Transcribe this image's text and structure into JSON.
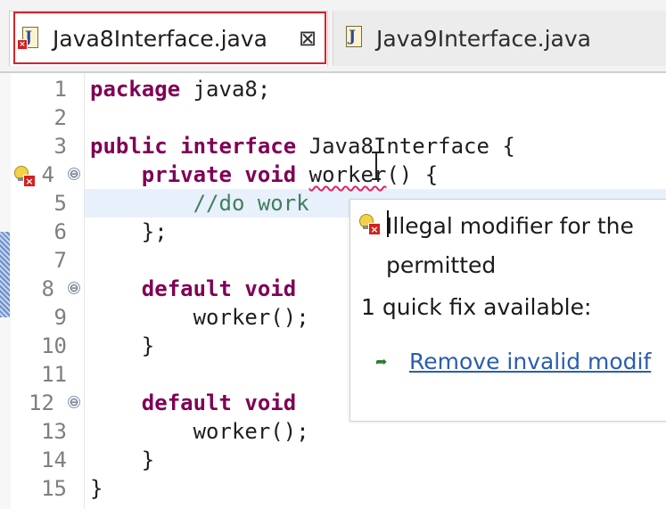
{
  "tabs": [
    {
      "label": "Java8Interface.java",
      "icon": "java-file-error-icon",
      "active": true,
      "close_glyph": "⊠"
    },
    {
      "label": "Java9Interface.java",
      "icon": "java-file-icon",
      "active": false
    }
  ],
  "editor": {
    "lines": [
      {
        "n": "1"
      },
      {
        "n": "2"
      },
      {
        "n": "3"
      },
      {
        "n": "4"
      },
      {
        "n": "5"
      },
      {
        "n": "6"
      },
      {
        "n": "7"
      },
      {
        "n": "8"
      },
      {
        "n": "9"
      },
      {
        "n": "10"
      },
      {
        "n": "11"
      },
      {
        "n": "12"
      },
      {
        "n": "13"
      },
      {
        "n": "14"
      },
      {
        "n": "15"
      }
    ],
    "code": {
      "l1_kw": "package",
      "l1_rest": " java8;",
      "l3_kw1": "public",
      "l3_kw2": "interface",
      "l3_rest": " Java8Interface {",
      "l4_indent": "    ",
      "l4_kw1": "private",
      "l4_kw2": "void",
      "l4_err": "worker",
      "l4_rest": "() {",
      "l5_comment": "        //do work",
      "l6": "    };",
      "l8_indent": "    ",
      "l8_kw1": "default",
      "l8_kw2": "void",
      "l9": "        worker();",
      "l10": "    }",
      "l12_indent": "    ",
      "l12_kw1": "default",
      "l12_kw2": "void",
      "l13": "        worker();",
      "l14": "    }",
      "l15": "}"
    },
    "fold_glyph": "⊖",
    "colors": {
      "keyword": "#7f0055",
      "comment": "#3f7f5f",
      "link": "#2a5db0",
      "error": "#d42020"
    }
  },
  "popup": {
    "message_line1": "Illegal modifier for the",
    "message_line2": "permitted",
    "quickfix_count": "1 quick fix available:",
    "fix_label": "Remove invalid modif"
  }
}
